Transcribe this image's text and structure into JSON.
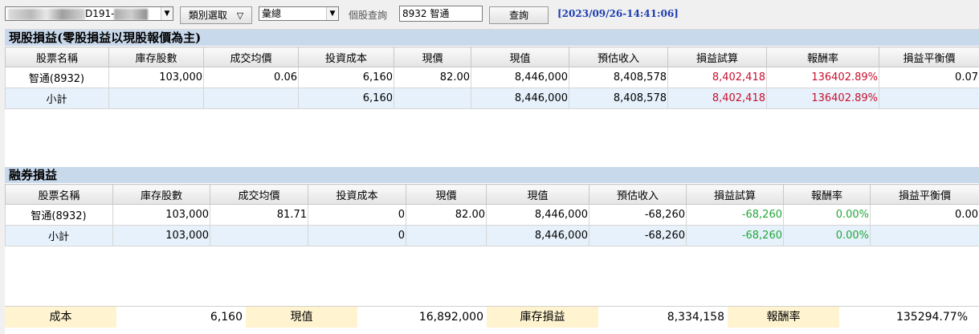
{
  "toolbar": {
    "account_value": "D191-",
    "category_select": "類別選取",
    "category_arrow": "▽",
    "summary_select": "彙總",
    "query_label": "個股查詢",
    "stock_input": "8932 智通",
    "query_button": "查詢",
    "timestamp": "[2023/09/26-14:41:06]"
  },
  "stock_section": {
    "title": "現股損益(零股損益以現股報價為主)",
    "headers": [
      "股票名稱",
      "庫存股數",
      "成交均價",
      "投資成本",
      "現價",
      "現值",
      "預估收入",
      "損益試算",
      "報酬率",
      "損益平衡價"
    ],
    "rows": [
      [
        "智通(8932)",
        "103,000",
        "0.06",
        "6,160",
        "82.00",
        "8,446,000",
        "8,408,578",
        "8,402,418",
        "136402.89%",
        "0.07"
      ],
      [
        "小計",
        "",
        "",
        "6,160",
        "",
        "8,446,000",
        "8,408,578",
        "8,402,418",
        "136402.89%",
        ""
      ]
    ]
  },
  "short_section": {
    "title": "融券損益",
    "headers": [
      "股票名稱",
      "庫存股數",
      "成交均價",
      "投資成本",
      "現價",
      "現值",
      "預估收入",
      "損益試算",
      "報酬率",
      "損益平衡價"
    ],
    "rows": [
      [
        "智通(8932)",
        "103,000",
        "81.71",
        "0",
        "82.00",
        "8,446,000",
        "-68,260",
        "-68,260",
        "0.00%",
        "0.00"
      ],
      [
        "小計",
        "103,000",
        "",
        "0",
        "",
        "8,446,000",
        "-68,260",
        "-68,260",
        "0.00%",
        ""
      ]
    ]
  },
  "footer": {
    "cost_label": "成本",
    "cost_value": "6,160",
    "market_label": "現值",
    "market_value": "16,892,000",
    "pnl_label": "庫存損益",
    "pnl_value": "8,334,158",
    "return_label": "報酬率",
    "return_value": "135294.77%"
  },
  "colors": {
    "gain": "#c8102e",
    "loss": "#22a63a",
    "header_bg": "#c9d9ec",
    "subtotal_bg": "#e6f1fb",
    "footer_label_bg": "#fff4cf"
  }
}
